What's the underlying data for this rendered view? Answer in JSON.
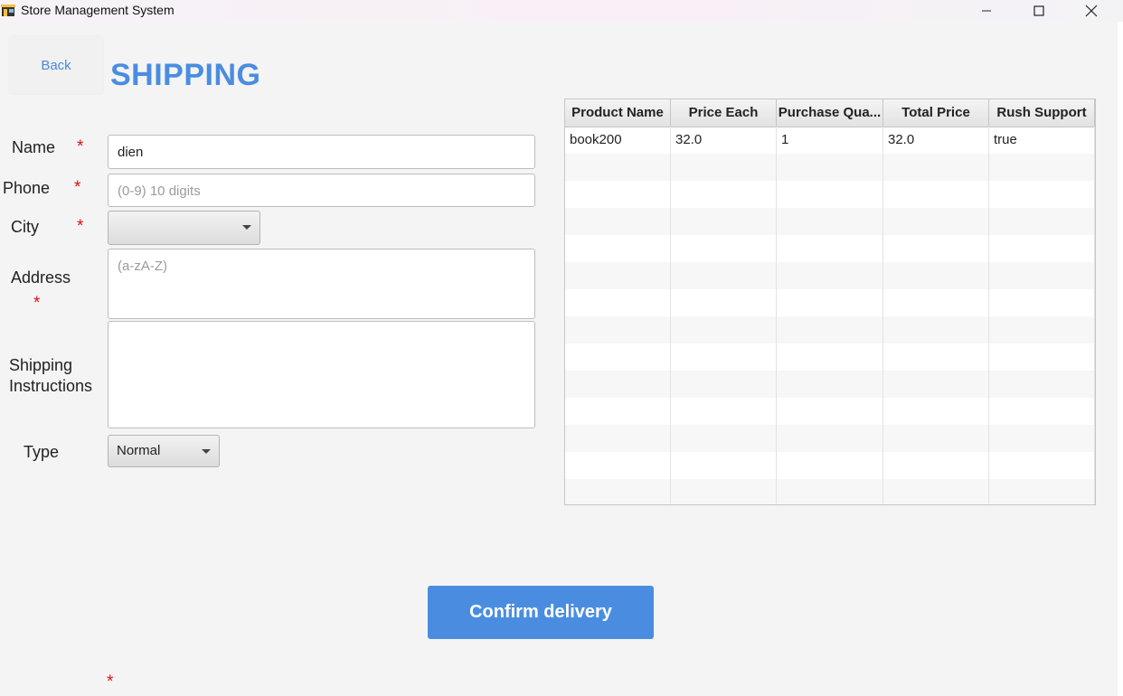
{
  "window": {
    "title": "Store Management System"
  },
  "header": {
    "back_label": "Back",
    "title": "SHIPPING"
  },
  "form": {
    "required_marker": "*",
    "name": {
      "label": "Name",
      "value": "dien"
    },
    "phone": {
      "label": "Phone",
      "placeholder": "(0-9) 10 digits",
      "value": ""
    },
    "city": {
      "label": "City",
      "value": ""
    },
    "address": {
      "label": "Address",
      "placeholder": "(a-zA-Z)",
      "value": ""
    },
    "instructions": {
      "label_line1": "Shipping",
      "label_line2": "Instructions",
      "value": ""
    },
    "type": {
      "label": "Type",
      "value": "Normal"
    }
  },
  "table": {
    "columns": [
      "Product Name",
      "Price Each",
      "Purchase Qua...",
      "Total Price",
      "Rush Support"
    ],
    "rows": [
      [
        "book200",
        "32.0",
        "1",
        "32.0",
        "true"
      ]
    ]
  },
  "actions": {
    "confirm_label": "Confirm delivery"
  },
  "colors": {
    "accent": "#4a8de0",
    "required": "#dd1111"
  }
}
